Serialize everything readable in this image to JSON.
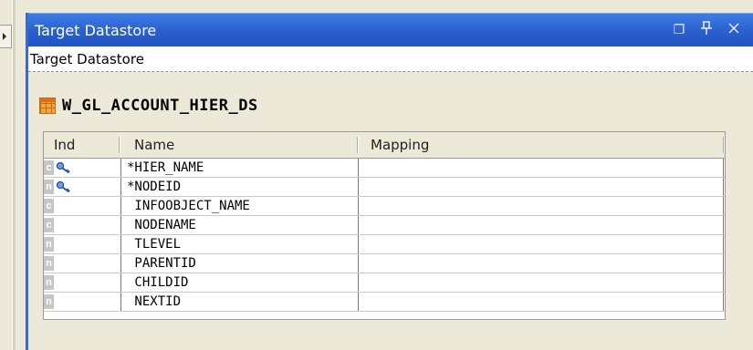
{
  "panel": {
    "title": "Target Datastore",
    "sub_header": "Target Datastore",
    "buttons": {
      "restore": "❐",
      "pin": "¤",
      "close": "×"
    }
  },
  "datastore": {
    "name": "W_GL_ACCOUNT_HIER_DS",
    "icon": "table-icon"
  },
  "grid": {
    "columns": [
      "Ind",
      "Name",
      "Mapping"
    ],
    "rows": [
      {
        "ind": "c",
        "key": true,
        "name": "*HIER_NAME",
        "mapping": ""
      },
      {
        "ind": "n",
        "key": true,
        "name": "*NODEID",
        "mapping": ""
      },
      {
        "ind": "c",
        "key": false,
        "name": " INFOOBJECT_NAME",
        "mapping": ""
      },
      {
        "ind": "c",
        "key": false,
        "name": " NODENAME",
        "mapping": ""
      },
      {
        "ind": "n",
        "key": false,
        "name": " TLEVEL",
        "mapping": ""
      },
      {
        "ind": "n",
        "key": false,
        "name": " PARENTID",
        "mapping": ""
      },
      {
        "ind": "n",
        "key": false,
        "name": " CHILDID",
        "mapping": ""
      },
      {
        "ind": "n",
        "key": false,
        "name": " NEXTID",
        "mapping": ""
      }
    ]
  },
  "colors": {
    "title_bar": "#2a5fce",
    "panel_bg": "#ece9d8",
    "badge": "#c6c6c6"
  }
}
